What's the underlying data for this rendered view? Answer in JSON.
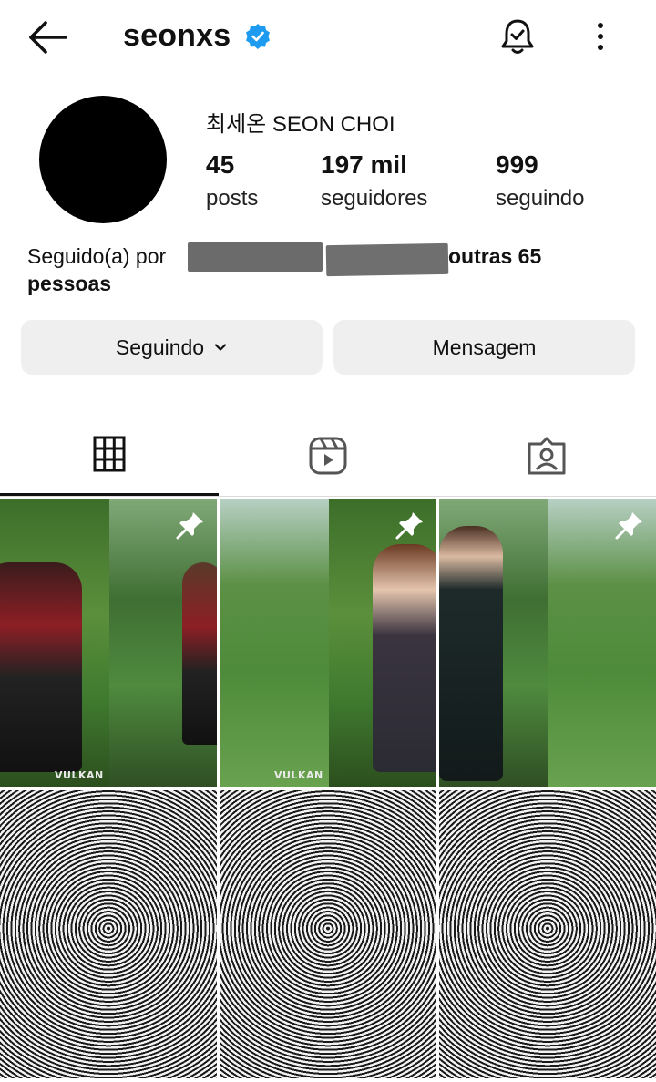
{
  "header": {
    "username": "seonxs",
    "verified": true,
    "icons": [
      "back-arrow-icon",
      "verified-badge-icon",
      "notification-bell-icon",
      "more-options-icon"
    ]
  },
  "profile": {
    "display_name": "최세온 SEON CHOI",
    "stats": {
      "posts": {
        "value": "45",
        "label": "posts"
      },
      "followers": {
        "value": "197 mil",
        "label": "seguidores"
      },
      "following": {
        "value": "999",
        "label": "seguindo"
      }
    },
    "followed_by": {
      "prefix": "Seguido(a) por",
      "suffix": "outras 65",
      "line2": "pessoas"
    }
  },
  "actions": {
    "following_label": "Seguindo",
    "message_label": "Mensagem"
  },
  "tabs": [
    "grid-icon",
    "reels-icon",
    "tagged-icon"
  ],
  "posts": [
    {
      "pinned": true,
      "caption_text": "VULKAN"
    },
    {
      "pinned": true,
      "caption_text": "VULKAN"
    },
    {
      "pinned": true,
      "caption_text": ""
    },
    {
      "pinned": false,
      "caption_text": ""
    },
    {
      "pinned": false,
      "caption_text": ""
    },
    {
      "pinned": false,
      "caption_text": ""
    }
  ],
  "colors": {
    "verified_blue": "#1d9bf0",
    "button_bg": "#efefef",
    "text": "#111111"
  }
}
